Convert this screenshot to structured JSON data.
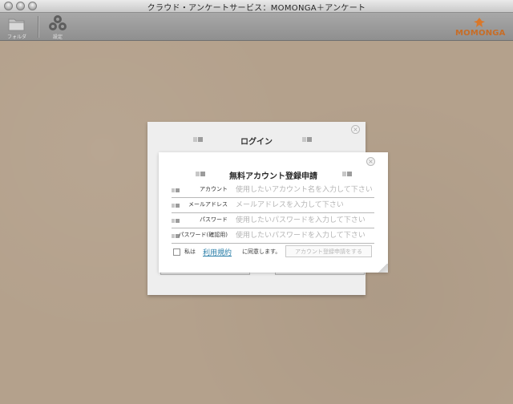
{
  "window": {
    "title": "クラウド・アンケートサービス：MOMONGA＋アンケート"
  },
  "toolbar": {
    "folder_label": "フォルダ",
    "settings_label": "設定",
    "logo_text": "MOMONGA"
  },
  "login_panel": {
    "title": "ログイン",
    "close_symbol": "×"
  },
  "register": {
    "title": "無料アカウント登録申請",
    "close_symbol": "×",
    "fields": [
      {
        "label": "アカウント",
        "placeholder": "使用したいアカウント名を入力して下さい"
      },
      {
        "label": "メールアドレス",
        "placeholder": "メールアドレスを入力して下さい"
      },
      {
        "label": "パスワード",
        "placeholder": "使用したいパスワードを入力して下さい"
      },
      {
        "label": "パスワード(確認用)",
        "placeholder": "使用したいパスワードを入力して下さい"
      }
    ],
    "agree_prefix": "私は",
    "terms_link": "利用規約",
    "agree_suffix": "に同意します。",
    "submit_label": "アカウント登録申請をする"
  },
  "colors": {
    "background": "#b4a18c",
    "link": "#2a7ea8",
    "logo": "#c76d27"
  }
}
